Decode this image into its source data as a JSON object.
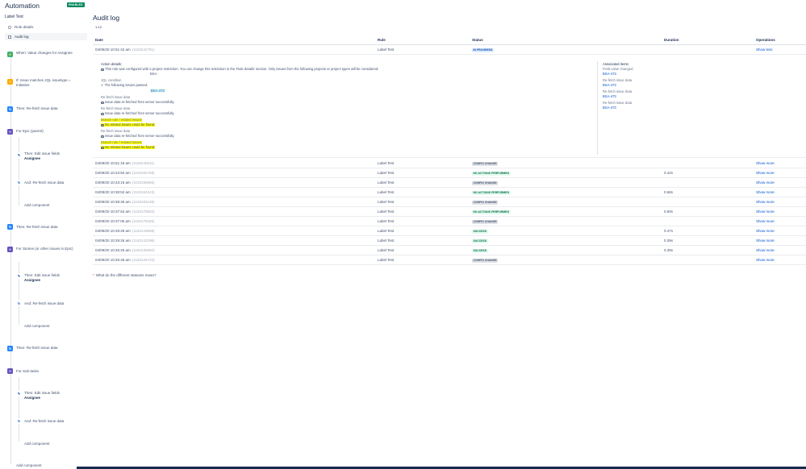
{
  "app": {
    "title": "Automation",
    "status_badge": "ENABLED"
  },
  "sidebar": {
    "rule_name": "Label Test",
    "nav": [
      {
        "label": "Rule details",
        "icon": "rule-details-icon"
      },
      {
        "label": "Audit log",
        "icon": "audit-log-icon"
      }
    ],
    "components": [
      {
        "label": "When: Value changes for Assignee",
        "icon": "trigger-icon"
      },
      {
        "label": "If: Issue matches JQL issuetype = Initiative",
        "icon": "condition-icon"
      },
      {
        "label": "Then: Re-fetch issue data",
        "icon": "refetch-icon"
      },
      {
        "label": "For Epic (parent)",
        "icon": "branch-icon"
      },
      {
        "label": "Then: Edit issue fields",
        "sub": "Assignee",
        "icon": "edit-icon"
      },
      {
        "label": "And: Re-fetch issue data",
        "icon": "refetch-icon"
      },
      {
        "label": "Add component"
      },
      {
        "label": "Then: Re-fetch issue data",
        "icon": "refetch-icon"
      },
      {
        "label": "For Stories (or other issues in Epic)",
        "icon": "branch-icon"
      },
      {
        "label": "Then: Edit issue fields",
        "sub": "Assignee",
        "icon": "edit-icon"
      },
      {
        "label": "And: Re-fetch issue data",
        "icon": "refetch-icon"
      },
      {
        "label": "Add component"
      },
      {
        "label": "Then: Re-fetch issue data",
        "icon": "refetch-icon"
      },
      {
        "label": "For Sub-tasks",
        "icon": "branch-icon"
      },
      {
        "label": "Then: Edit issue fields",
        "sub": "Assignee",
        "icon": "edit-icon"
      },
      {
        "label": "And: Re-fetch issue data",
        "icon": "refetch-icon"
      },
      {
        "label": "Add component"
      },
      {
        "label": "Add component"
      }
    ]
  },
  "main": {
    "title": "Audit log",
    "range": "1-12",
    "columns": [
      "Date",
      "Rule",
      "Status",
      "Duration",
      "Operations"
    ],
    "first_row": {
      "date": "04/09/20 10:51:42 am",
      "id": "(1183242791)",
      "rule": "Label Test",
      "status": "IN PROGRESS",
      "duration": "",
      "op": "Show less"
    },
    "details": {
      "action_heading": "Action details:",
      "restriction_note": "This rule was configured with a project restriction. You can change this restriction in the 'Rule details' section. Only issues from the following projects or project types will be considered:",
      "project": "BSA",
      "jql_heading": "JQL condition",
      "issues_passed": "The following issues passed:",
      "issue_key": "BSA-473",
      "refetch_title": "Re-fetch issue data",
      "refetch_msg": "Issue data re-fetched from server successfully.",
      "branch_title": "Branch rule / related issues",
      "branch_msg": "No related issues could be found.",
      "associated_heading": "Associated items:",
      "associated": [
        {
          "label": "Field value changed",
          "key": "BSA-473"
        },
        {
          "label": "Re-fetch issue data",
          "key": "BSA-473"
        },
        {
          "label": "Re-fetch issue data",
          "key": "BSA-473"
        },
        {
          "label": "Re-fetch issue data",
          "key": "BSA-473"
        }
      ]
    },
    "rows": [
      {
        "date": "04/09/20 10:51:18 am",
        "id": "(1183240511)",
        "rule": "Label Test",
        "status": "CONFIG CHANGE",
        "kind": "config",
        "duration": "",
        "op": "Show more"
      },
      {
        "date": "04/09/20 10:43:50 am",
        "id": "(1183192758)",
        "rule": "Label Test",
        "status": "NO ACTIONS PERFORMED",
        "kind": "noaction",
        "duration": "0.42s",
        "op": "Show more"
      },
      {
        "date": "04/09/20 10:43:19 am",
        "id": "(1183190566)",
        "rule": "Label Test",
        "status": "CONFIG CHANGE",
        "kind": "config",
        "duration": "",
        "op": "Show more"
      },
      {
        "date": "04/09/20 10:38:52 am",
        "id": "(1183184243)",
        "rule": "Label Test",
        "status": "NO ACTIONS PERFORMED",
        "kind": "noaction",
        "duration": "0.68s",
        "op": "Show more"
      },
      {
        "date": "04/09/20 10:38:36 am",
        "id": "(1183183139)",
        "rule": "Label Test",
        "status": "CONFIG CHANGE",
        "kind": "config",
        "duration": "",
        "op": "Show more"
      },
      {
        "date": "04/09/20 10:37:53 am",
        "id": "(1183178820)",
        "rule": "Label Test",
        "status": "NO ACTIONS PERFORMED",
        "kind": "noaction",
        "duration": "0.60s",
        "op": "Show more"
      },
      {
        "date": "04/09/20 10:37:05 am",
        "id": "(1183176345)",
        "rule": "Label Test",
        "status": "CONFIG CHANGE",
        "kind": "config",
        "duration": "",
        "op": "Show more"
      },
      {
        "date": "04/09/20 10:29:29 am",
        "id": "(1183143699)",
        "rule": "Label Test",
        "status": "SUCCESS",
        "kind": "success",
        "duration": "0.47s",
        "op": "Show more"
      },
      {
        "date": "04/09/20 10:29:26 am",
        "id": "(1183143296)",
        "rule": "Label Test",
        "status": "SUCCESS",
        "kind": "success",
        "duration": "0.39s",
        "op": "Show more"
      },
      {
        "date": "04/09/20 10:26:25 am",
        "id": "(1183130060)",
        "rule": "Label Test",
        "status": "SUCCESS",
        "kind": "success",
        "duration": "0.39s",
        "op": "Show more"
      },
      {
        "date": "04/09/20 10:25:45 am",
        "id": "(1183126710)",
        "rule": "Label Test",
        "status": "CONFIG CHANGE",
        "kind": "config",
        "duration": "",
        "op": "Show more"
      }
    ],
    "footnote": "What do the different statuses mean?"
  },
  "colors": {
    "link": "#0052cc",
    "highlight": "#ffff00",
    "enabled": "#00875a",
    "text": "#172b4d"
  }
}
